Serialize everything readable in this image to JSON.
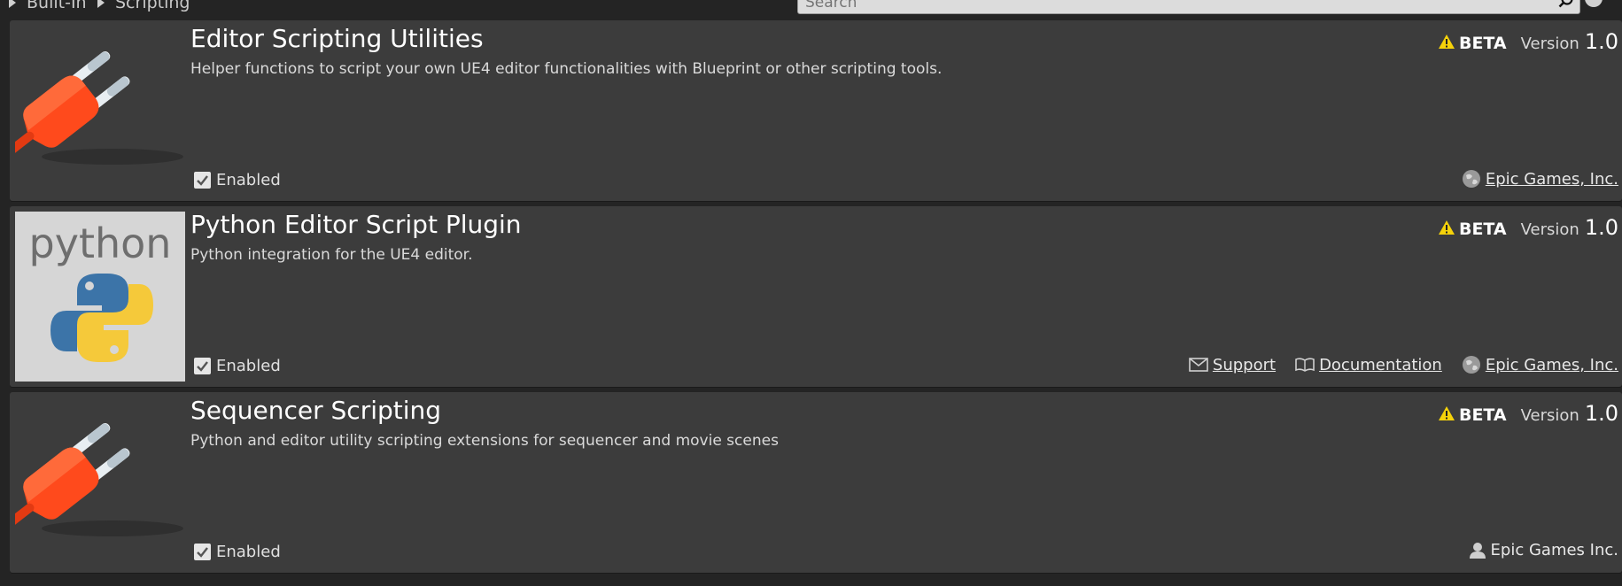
{
  "breadcrumb": {
    "items": [
      "Built-In",
      "Scripting"
    ]
  },
  "search": {
    "placeholder": "Search"
  },
  "plugins": [
    {
      "title": "Editor Scripting Utilities",
      "description": "Helper functions to script your own UE4 editor functionalities with Blueprint or other scripting tools.",
      "badge": "BETA",
      "version_label": "Version",
      "version": "1.0",
      "enabled_label": "Enabled",
      "enabled": true,
      "icon": "plug-icon",
      "links": [],
      "author": "Epic Games, Inc."
    },
    {
      "title": "Python Editor Script Plugin",
      "description": "Python integration for the UE4 editor.",
      "badge": "BETA",
      "version_label": "Version",
      "version": "1.0",
      "enabled_label": "Enabled",
      "enabled": true,
      "icon": "python-logo",
      "icon_text": "python",
      "links": [
        "Support",
        "Documentation"
      ],
      "author": "Epic Games, Inc."
    },
    {
      "title": "Sequencer Scripting",
      "description": "Python and editor utility scripting extensions for sequencer and movie scenes",
      "badge": "BETA",
      "version_label": "Version",
      "version": "1.0",
      "enabled_label": "Enabled",
      "enabled": true,
      "icon": "plug-icon",
      "links": [],
      "author": "Epic Games Inc."
    }
  ],
  "colors": {
    "background": "#242424",
    "card": "#3c3c3c",
    "plug": "#ff4a1c",
    "warning": "#f5d20a",
    "python_blue": "#3c74a8",
    "python_yellow": "#f5c93a"
  }
}
